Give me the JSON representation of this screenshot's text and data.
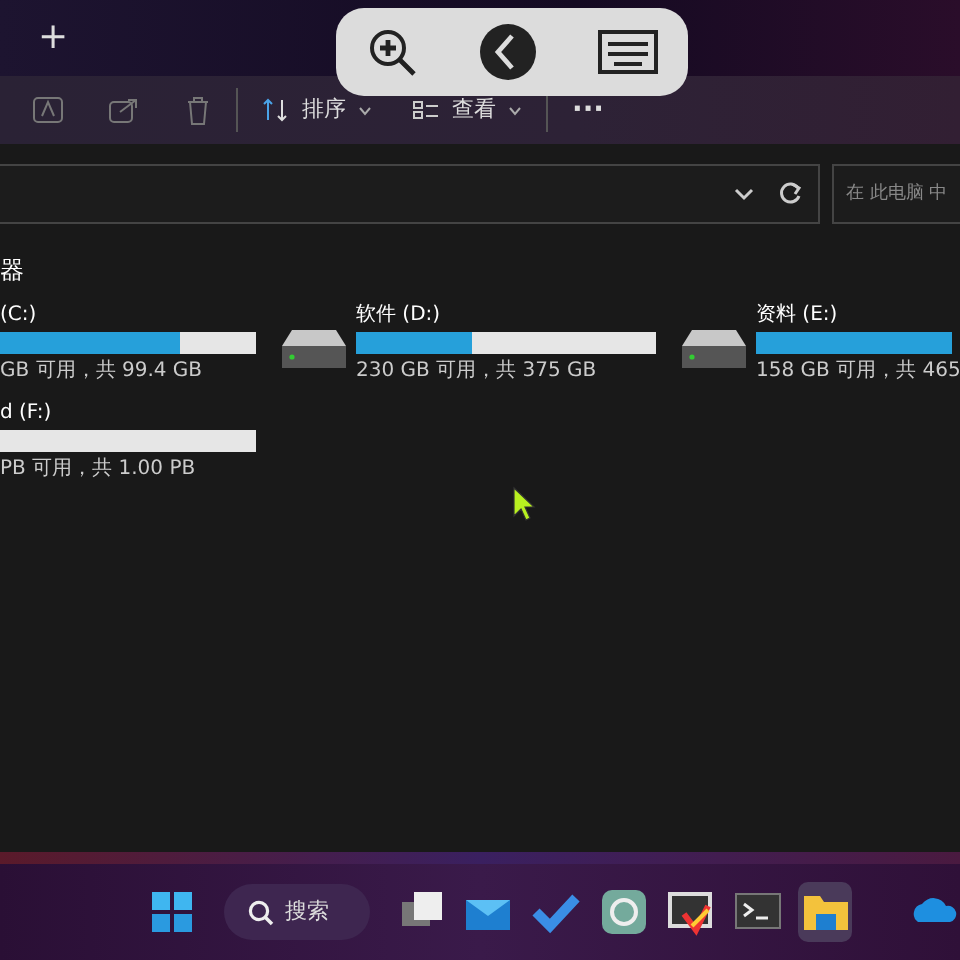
{
  "tabbar": {
    "new_tab": "+"
  },
  "toolbar": {
    "sort_label": "排序",
    "view_label": "查看",
    "more": "···"
  },
  "address_bar": {
    "search_placeholder": "在 此电脑 中"
  },
  "section": {
    "title": "器",
    "drives": [
      {
        "kind": "cut",
        "label": "(C:)",
        "level": 0.7,
        "info": "GB 可用，共 99.4 GB"
      },
      {
        "kind": "full",
        "label": "软件 (D:)",
        "level": 0.387,
        "info": "230 GB 可用，共 375 GB"
      },
      {
        "kind": "full",
        "label": "资料 (E:)",
        "level": 1,
        "info": "158 GB 可用，共 465"
      },
      {
        "kind": "cut",
        "label": "d (F:)",
        "info": "PB 可用，共 1.00 PB"
      }
    ]
  },
  "taskbar": {
    "search_label": "搜索",
    "apps": [
      {
        "kind": "widgets",
        "selected": false
      },
      {
        "kind": "mail",
        "selected": false
      },
      {
        "kind": "todo",
        "selected": false
      },
      {
        "kind": "chat",
        "selected": false
      },
      {
        "kind": "paint",
        "selected": false
      },
      {
        "kind": "terminal",
        "selected": false
      },
      {
        "kind": "folder",
        "selected": true
      },
      {
        "kind": "cloud",
        "selected": false
      }
    ]
  }
}
